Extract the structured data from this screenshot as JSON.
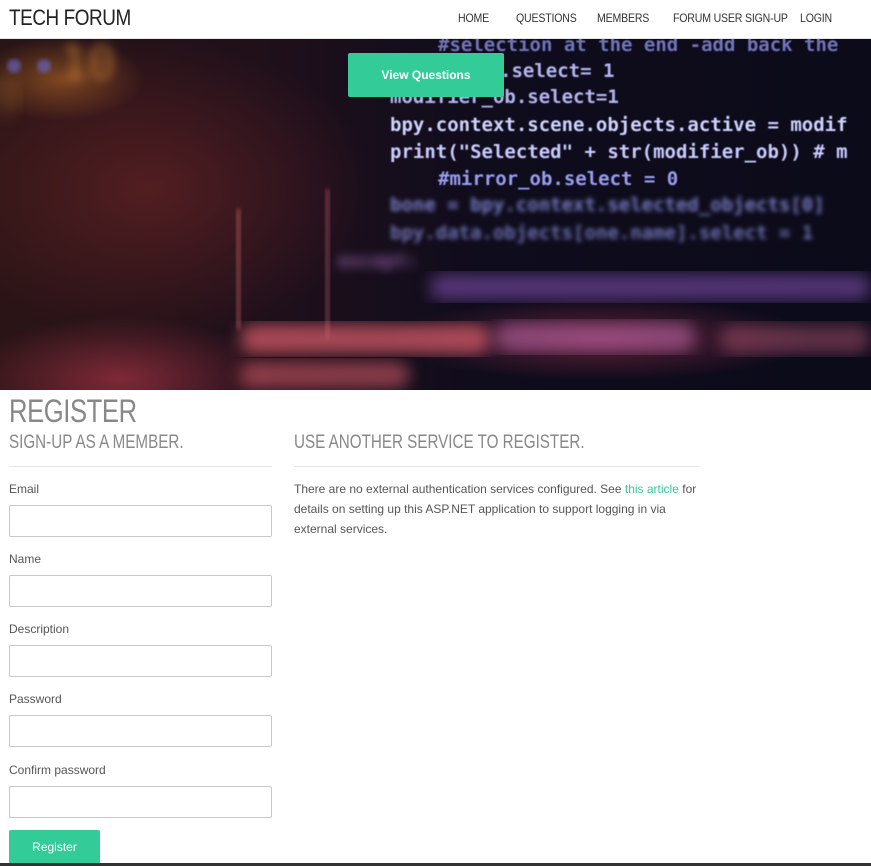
{
  "brand": "TECH FORUM",
  "nav": {
    "items": [
      {
        "label": "HOME"
      },
      {
        "label": "QUESTIONS"
      },
      {
        "label": "MEMBERS"
      },
      {
        "label": "FORUM USER SIGN-UP"
      },
      {
        "label": "LOGIN"
      }
    ]
  },
  "hero": {
    "button_label": "View Questions",
    "code_lines": [
      "#selection at the end -add back the",
      ".select= 1",
      "modifier_ob.select=1",
      "bpy.context.scene.objects.active = modif",
      "print(\"Selected\" + str(modifier_ob)) # m",
      "#mirror_ob.select = 0",
      "bone = bpy.context.selected_objects[0]",
      "bpy.data.objects[one.name].select = 1",
      "except:"
    ]
  },
  "page": {
    "title": "REGISTER"
  },
  "signup": {
    "heading": "SIGN-UP AS A MEMBER.",
    "fields": {
      "email": {
        "label": "Email",
        "value": ""
      },
      "name": {
        "label": "Name",
        "value": ""
      },
      "description": {
        "label": "Description",
        "value": ""
      },
      "password": {
        "label": "Password",
        "value": ""
      },
      "confirm": {
        "label": "Confirm password",
        "value": ""
      }
    },
    "submit_label": "Register"
  },
  "external": {
    "heading": "USE ANOTHER SERVICE TO REGISTER.",
    "text_before": "There are no external authentication services configured. See ",
    "link_text": "this article",
    "text_after": " for details on setting up this ASP.NET application to support logging in via external services."
  },
  "colors": {
    "accent": "#33cc99",
    "heading": "#888888"
  }
}
